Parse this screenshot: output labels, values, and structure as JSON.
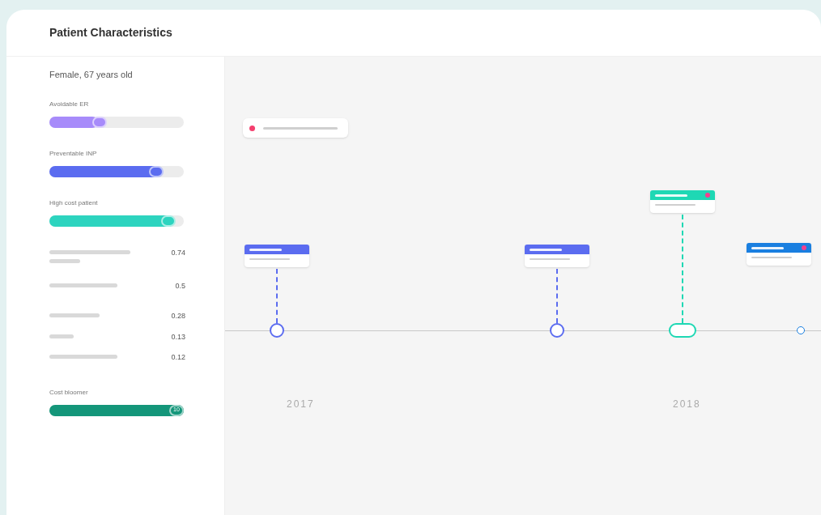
{
  "panel": {
    "title": "Patient Characteristics"
  },
  "sidebar": {
    "summary": "Female, 67 years old",
    "sliders": [
      {
        "label": "Avoidable ER",
        "level": 0.36,
        "color": "#a78bfa"
      },
      {
        "label": "Preventable INP",
        "level": 0.83,
        "color": "#5b6cf0"
      },
      {
        "label": "High cost patient",
        "level": 0.93,
        "color": "#2dd4bf"
      }
    ],
    "scores": [
      {
        "value": "0.74"
      },
      {
        "value": "0.5"
      },
      {
        "value": "0.28"
      },
      {
        "value": "0.13"
      },
      {
        "value": "0.12"
      }
    ],
    "bottom_slider": {
      "label": "Cost bloomer",
      "level": 1,
      "reading": "10",
      "color": "#14967a"
    }
  },
  "timeline": {
    "events": [
      {
        "kind": "circle",
        "color": "#5b6cf0",
        "flagged": false
      },
      {
        "kind": "circle",
        "color": "#5b6cf0",
        "flagged": false
      },
      {
        "kind": "pill",
        "color": "#1ed8b4",
        "flagged": true
      },
      {
        "kind": "small",
        "color": "#1a7fe0",
        "flagged": true
      }
    ],
    "years": [
      "2017",
      "2018"
    ]
  }
}
